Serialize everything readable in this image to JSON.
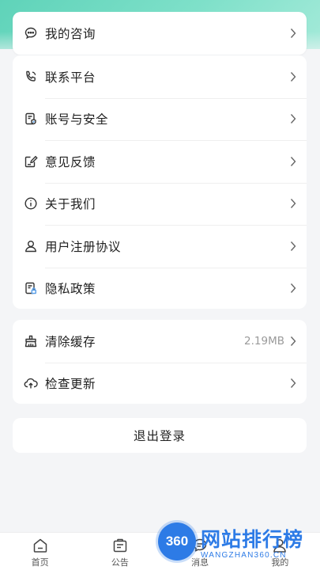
{
  "menu": {
    "consult": {
      "label": "我的咨询",
      "icon": "chat-icon"
    },
    "items": [
      {
        "label": "联系平台",
        "icon": "phone-icon"
      },
      {
        "label": "账号与安全",
        "icon": "account-security-icon"
      },
      {
        "label": "意见反馈",
        "icon": "feedback-icon"
      },
      {
        "label": "关于我们",
        "icon": "info-icon"
      },
      {
        "label": "用户注册协议",
        "icon": "user-icon"
      },
      {
        "label": "隐私政策",
        "icon": "privacy-icon"
      }
    ]
  },
  "storage": {
    "clear_cache": {
      "label": "清除缓存",
      "value": "2.19MB",
      "icon": "broom-icon"
    },
    "check_update": {
      "label": "检查更新",
      "icon": "cloud-upload-icon"
    }
  },
  "logout_label": "退出登录",
  "tabbar": {
    "tabs": [
      {
        "label": "首页",
        "icon": "home-icon"
      },
      {
        "label": "公告",
        "icon": "notice-icon"
      },
      {
        "label": "消息",
        "icon": "message-icon"
      },
      {
        "label": "我的",
        "icon": "profile-icon"
      }
    ]
  },
  "watermark": {
    "badge": "360",
    "title": "网站排行榜",
    "subtitle": "WANGZHAN360.CN"
  },
  "colors": {
    "accent": "#5fd3b9",
    "background": "#f4f5f7",
    "icon": "#333333",
    "watermark": "#2d7be6"
  }
}
